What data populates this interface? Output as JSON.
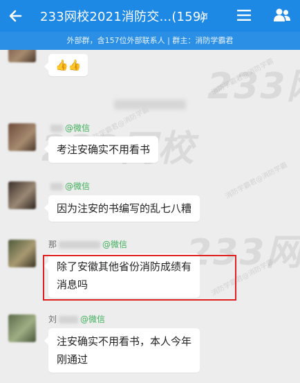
{
  "header": {
    "title": "233网校2021消防交...(159)",
    "subtitle": "外部群，含157位外部联系人 | 群主：消防学霸君",
    "bg_color": "#1e88e5"
  },
  "watermark": {
    "brand": "233网校",
    "brand_alt": "233网",
    "text": "消防学霸君@消防学霸"
  },
  "messages": [
    {
      "sender_initial": "",
      "tag": "",
      "text": "👍👍"
    },
    {
      "sender_initial": "",
      "tag": "@微信",
      "text": "考注安确实不用看书"
    },
    {
      "sender_initial": "",
      "tag": "@微信",
      "text": "因为注安的书编写的乱七八糟"
    },
    {
      "sender_initial": "那",
      "tag": "@微信",
      "text_line1": "除了安徽其他省份消防成绩有",
      "text_line2": "消息吗"
    },
    {
      "sender_initial": "刘",
      "tag": "@微信",
      "text_line1": "注安确实不用看书，本人今年",
      "text_line2": "刚通过"
    }
  ],
  "highlight_color": "#e02020"
}
